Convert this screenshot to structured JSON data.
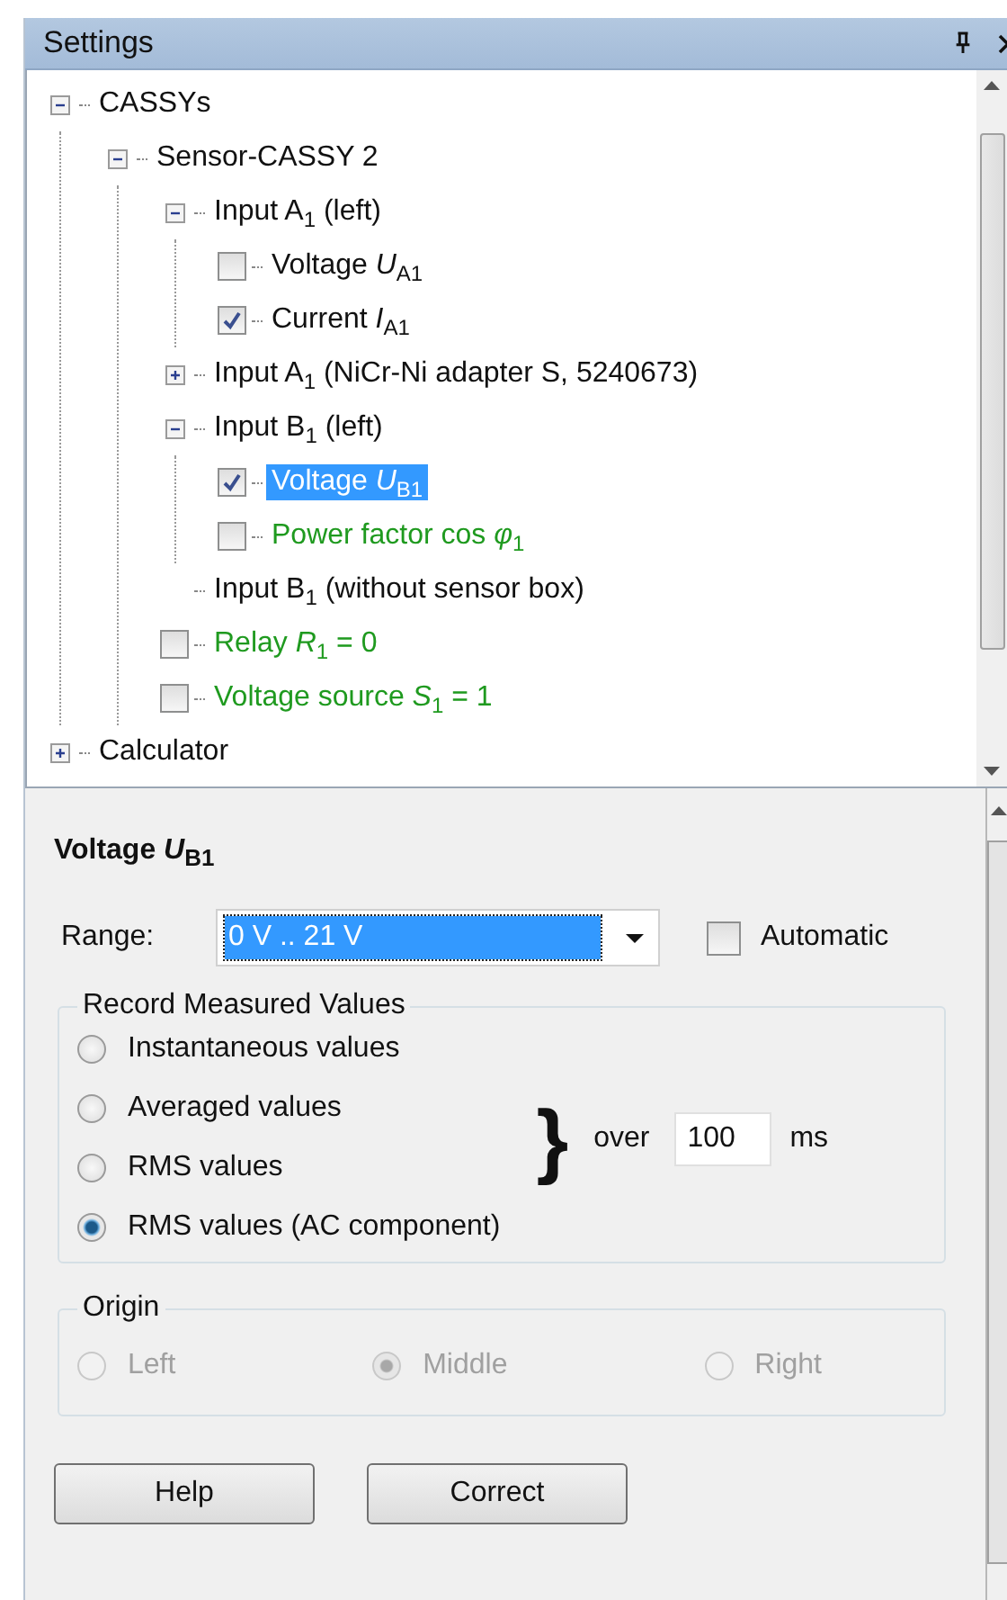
{
  "window": {
    "title": "Settings"
  },
  "tree": [
    {
      "label": "CASSYs",
      "expanded": true,
      "selected": false,
      "children": [
        {
          "label": "Sensor-CASSY 2",
          "expanded": true,
          "selected": false,
          "children": [
            {
              "label": "Input A$_{1}$ (left)",
              "expanded": true,
              "selected": false,
              "children": [
                {
                  "label": "Voltage *U*$_{A1}$",
                  "checked": false,
                  "selected": false
                },
                {
                  "label": "Current *I*$_{A1}$",
                  "checked": true,
                  "selected": false
                }
              ]
            },
            {
              "label": "Input A$_{1}$ (NiCr-Ni adapter S, 5240673)",
              "expanded": false,
              "selected": false
            },
            {
              "label": "Input B$_{1}$ (left)",
              "expanded": true,
              "selected": false,
              "children": [
                {
                  "label": "Voltage *U*$_{B1}$",
                  "checked": true,
                  "selected": true
                },
                {
                  "label": "Power factor cos *φ*$_{1}$",
                  "checked": false,
                  "selected": false,
                  "color": "#1f9a1f"
                }
              ]
            },
            {
              "label": "Input B$_{1}$ (without sensor box)",
              "selected": false
            },
            {
              "label": "Relay *R*$_{1}$ = 0",
              "checked": false,
              "selected": false,
              "color": "#1f9a1f"
            },
            {
              "label": "Voltage source *S*$_{1}$ = 1",
              "checked": false,
              "selected": false,
              "color": "#1f9a1f"
            }
          ]
        }
      ]
    },
    {
      "label": "Calculator",
      "expanded": false,
      "selected": false
    }
  ],
  "detail": {
    "title": "Voltage *U*$_{B1}$",
    "range": {
      "label": "Range:",
      "value": "0 V .. 21 V"
    },
    "automatic": {
      "label": "Automatic",
      "checked": false
    },
    "record_group": {
      "title": "Record Measured Values",
      "options": [
        {
          "label": "Instantaneous values",
          "selected": false
        },
        {
          "label": "Averaged values",
          "selected": false
        },
        {
          "label": "RMS values",
          "selected": false
        },
        {
          "label": "RMS values (AC component)",
          "selected": true
        }
      ],
      "brace": "}",
      "over_label": "over",
      "interval": "100",
      "unit": "ms"
    },
    "origin_group": {
      "title": "Origin",
      "disabled": true,
      "options": [
        {
          "label": "Left",
          "selected": false
        },
        {
          "label": "Middle",
          "selected": true
        },
        {
          "label": "Right",
          "selected": false
        }
      ]
    }
  },
  "buttons": [
    "Help",
    "Correct"
  ]
}
